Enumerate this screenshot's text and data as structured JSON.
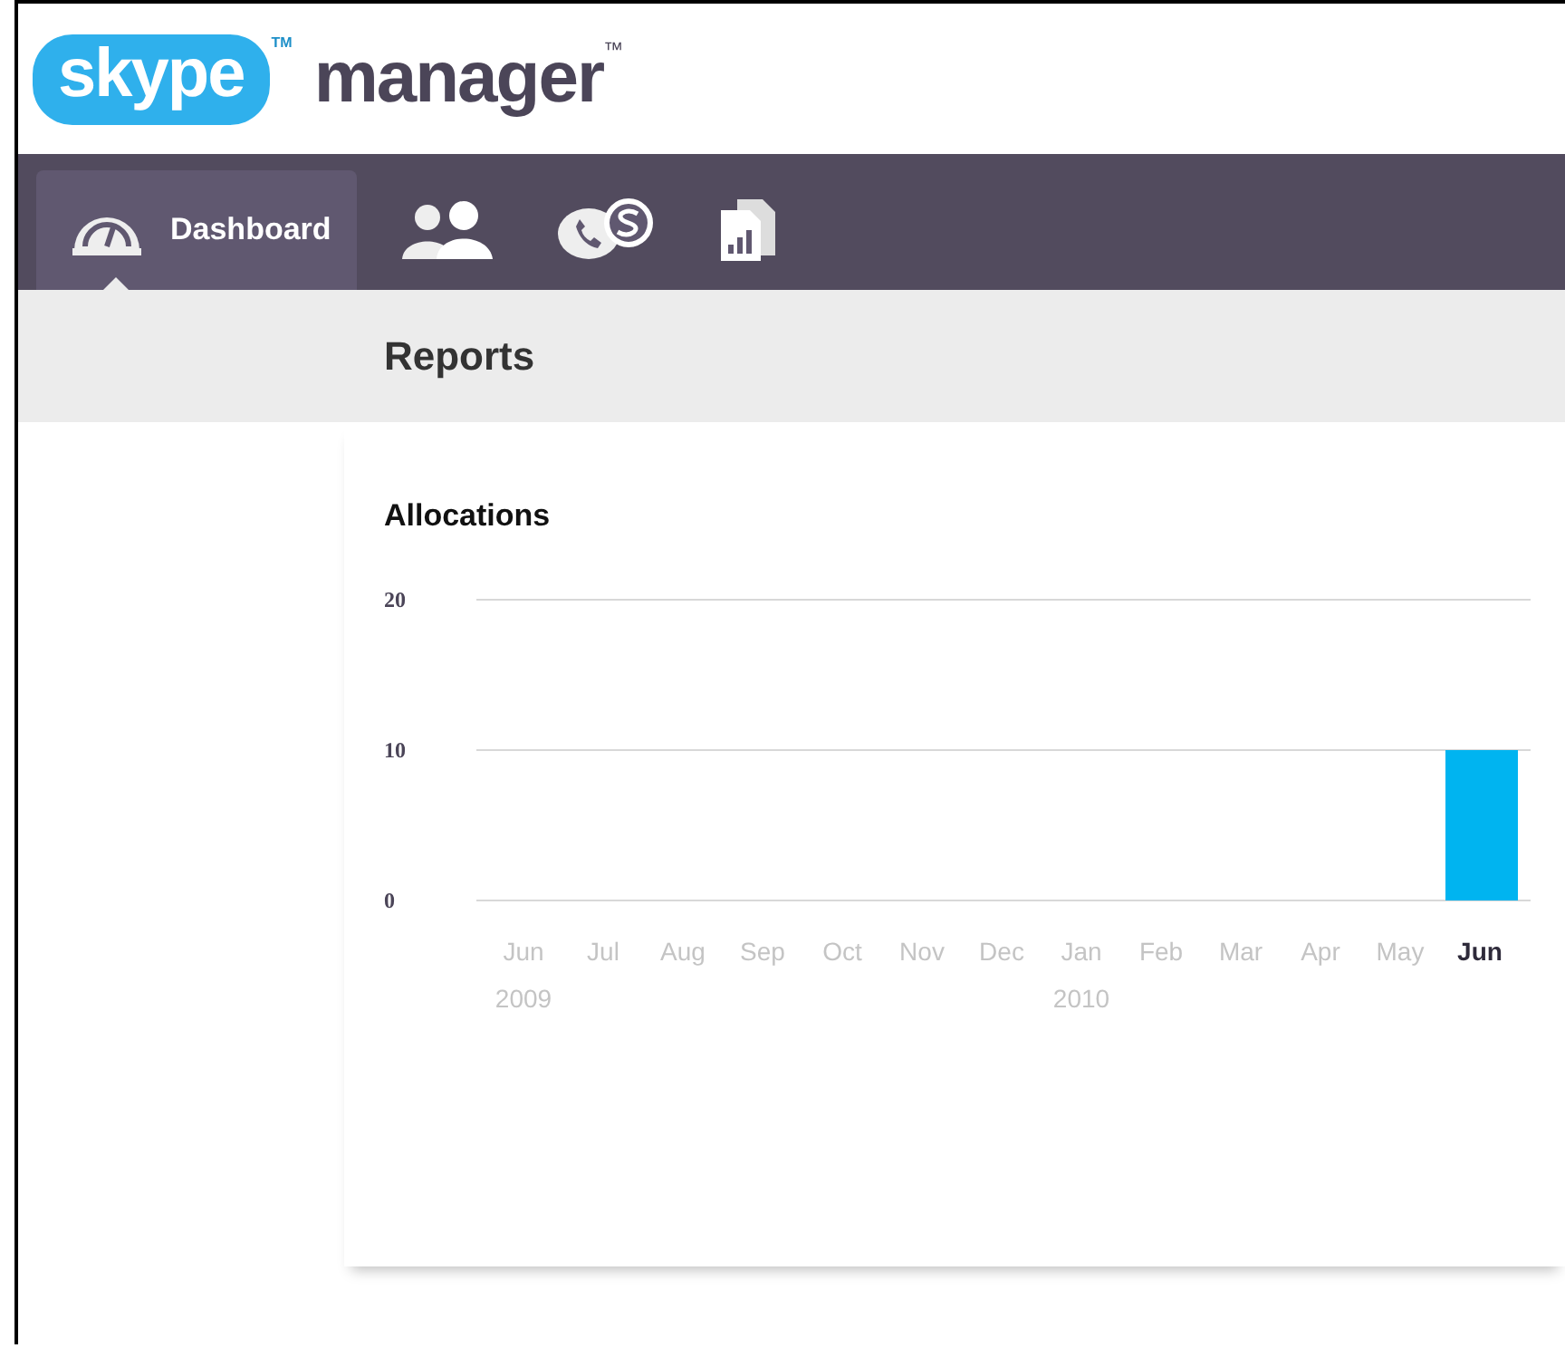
{
  "header": {
    "logo": {
      "text": "skype",
      "mark": "TM"
    },
    "product": "manager",
    "trademark": "™"
  },
  "nav": {
    "items": [
      {
        "kind": "dashboard",
        "label": "Dashboard",
        "selected": true
      },
      {
        "kind": "people",
        "selected": false
      },
      {
        "kind": "skype",
        "selected": false
      },
      {
        "kind": "reports",
        "selected": false
      }
    ]
  },
  "page_title": "Reports",
  "chart": {
    "category_marks": [
      {
        "selected": false,
        "year": "2009"
      },
      {
        "selected": false
      },
      {
        "selected": false
      },
      {
        "selected": false
      },
      {
        "selected": false
      },
      {
        "selected": false
      },
      {
        "selected": false
      },
      {
        "selected": false,
        "year": "2010"
      },
      {
        "selected": false
      },
      {
        "selected": false
      },
      {
        "selected": false
      },
      {
        "selected": false
      },
      {
        "selected": true
      }
    ],
    "chart_data": {
      "type": "bar",
      "title": "Allocations",
      "categories": [
        "Jun",
        "Jul",
        "Aug",
        "Sep",
        "Oct",
        "Nov",
        "Dec",
        "Jan",
        "Feb",
        "Mar",
        "Apr",
        "May",
        "Jun"
      ],
      "series": [
        {
          "color": "#00b4f0",
          "values": [
            0,
            0,
            0,
            0,
            0,
            0,
            0,
            0,
            0,
            0,
            0,
            0,
            10
          ]
        }
      ],
      "ylim": [
        0,
        20
      ],
      "yticks": [
        0,
        10,
        20
      ]
    }
  }
}
